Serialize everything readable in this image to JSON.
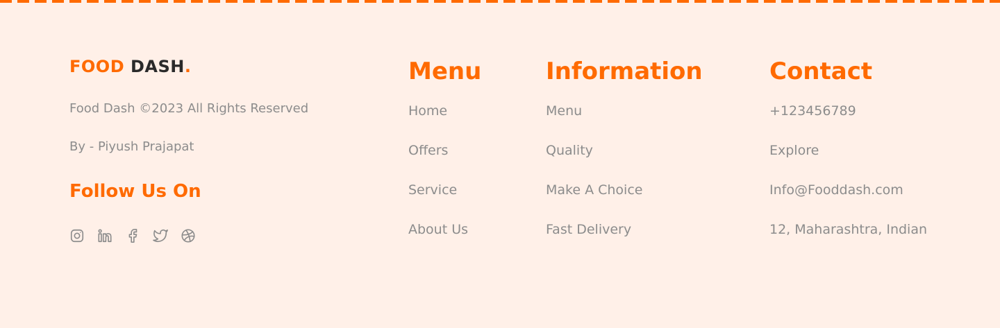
{
  "brand": {
    "part1": "FOOD",
    "part2": "DASH",
    "dot": "."
  },
  "copyright": "Food Dash ©2023 All Rights Reserved",
  "byline": "By - Piyush Prajapat",
  "follow_title": "Follow Us On",
  "socials": [
    "instagram-icon",
    "linkedin-icon",
    "facebook-icon",
    "twitter-icon",
    "dribbble-icon"
  ],
  "colors": {
    "accent": "#ff6a00",
    "muted": "#8c8c8c",
    "background": "#fff0e8",
    "dark": "#2a2a2a"
  },
  "menu": {
    "title": "Menu",
    "items": [
      "Home",
      "Offers",
      "Service",
      "About Us"
    ]
  },
  "information": {
    "title": "Information",
    "items": [
      "Menu",
      "Quality",
      "Make A Choice",
      "Fast Delivery"
    ]
  },
  "contact": {
    "title": "Contact",
    "items": [
      "+123456789",
      "Explore",
      "Info@Fooddash.com",
      "12, Maharashtra, Indian"
    ]
  }
}
